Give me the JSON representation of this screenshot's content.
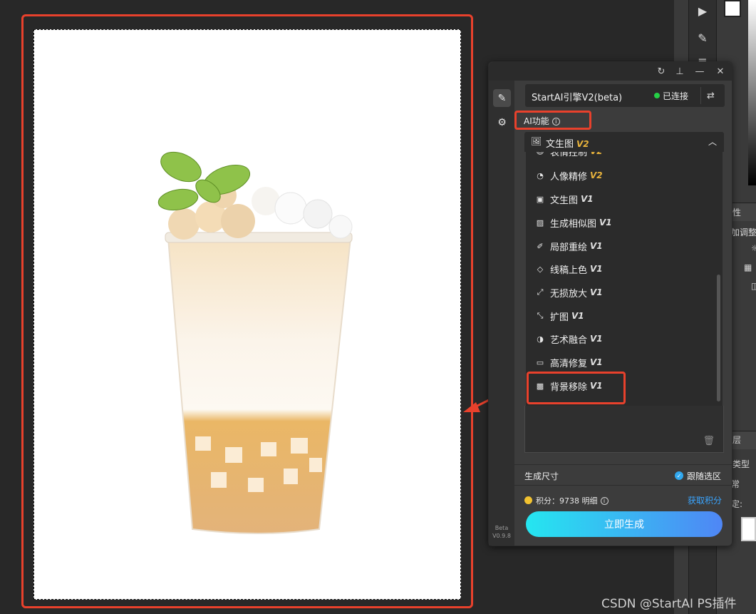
{
  "panel": {
    "engine_title": "StartAI引擎V2(beta)",
    "status_text": "已连接",
    "section_label": "AI功能",
    "dropdown_selected": {
      "label": "文生图",
      "version": "V2"
    },
    "menu_items": [
      {
        "label": "表情控制",
        "version": "V2",
        "icon": "face-icon"
      },
      {
        "label": "人像精修",
        "version": "V2",
        "icon": "portrait-icon"
      },
      {
        "label": "文生图",
        "version": "V1",
        "icon": "text-to-image-icon"
      },
      {
        "label": "生成相似图",
        "version": "V1",
        "icon": "similar-image-icon"
      },
      {
        "label": "局部重绘",
        "version": "V1",
        "icon": "brush-icon"
      },
      {
        "label": "线稿上色",
        "version": "V1",
        "icon": "paint-bucket-icon"
      },
      {
        "label": "无损放大",
        "version": "V1",
        "icon": "upscale-icon"
      },
      {
        "label": "扩图",
        "version": "V1",
        "icon": "expand-icon"
      },
      {
        "label": "艺术融合",
        "version": "V1",
        "icon": "art-blend-icon"
      },
      {
        "label": "高清修复",
        "version": "V1",
        "icon": "hd-icon"
      },
      {
        "label": "背景移除",
        "version": "V1",
        "icon": "background-remove-icon"
      }
    ],
    "size_label": "生成尺寸",
    "follow_selection": "跟随选区",
    "points_text": "积分：9738 明细",
    "get_points": "获取积分",
    "generate_button": "立即生成",
    "version_beta": "Beta",
    "version_number": "V0.9.8"
  },
  "ps_side": {
    "props_label": "性",
    "adjust_label": "加调整",
    "layers_label": "层",
    "type_label": "类型",
    "normal_label": "常",
    "lock_label": "定:"
  },
  "watermark": "CSDN @StartAI PS插件",
  "colors": {
    "highlight": "#e8412c",
    "accent_v2": "#e8b33c",
    "link": "#3aa5ff",
    "connected": "#25d046"
  }
}
